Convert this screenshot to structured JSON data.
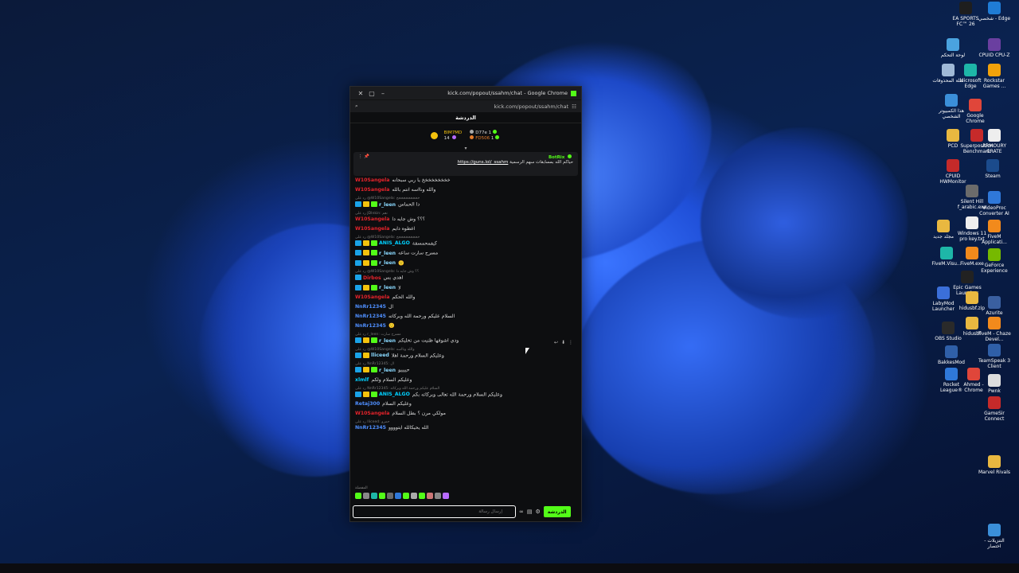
{
  "window": {
    "title": "kick.com/popout/ssahm/chat - Google Chrome",
    "url": "kick.com/popout/ssahm/chat"
  },
  "chat": {
    "header": "الدردشة",
    "leaderboard": [
      {
        "name": "BIM7MD",
        "count": "14"
      },
      {
        "name": "D77e",
        "count": "1"
      },
      {
        "name": "FD506",
        "count": "1"
      }
    ],
    "pinned": {
      "author": "BotRix",
      "text": "حياكم الله بمسابقات سهم الرسمية",
      "link": "https://guns.lol/_ssahm"
    },
    "messages": [
      {
        "reply": "",
        "user": "W10Sangela",
        "color": "#e5232b",
        "badges": 0,
        "text": "خخخخخخخخخ يا ربي سبحانه"
      },
      {
        "reply": "",
        "user": "W10Sangela",
        "color": "#e5232b",
        "badges": 0,
        "text": "والله ونااسه انتم بالله"
      },
      {
        "reply": "رد على @W10Sangela: خخخخخخخخخخ",
        "user": "r_leen",
        "color": "#8ad9ff",
        "badges": 3,
        "text": "دا الحماس"
      },
      {
        "reply": "رد على JDlnkin: نعم",
        "user": "W10Sangela",
        "color": "#e5232b",
        "badges": 0,
        "text": "؟؟؟ وش جايه دا"
      },
      {
        "reply": "",
        "user": "W10Sangela",
        "color": "#e5232b",
        "badges": 0,
        "text": "اعطوه دايم"
      },
      {
        "reply": "رد على @W10Sangela: خخخخخخخخخخ",
        "user": "ANIS_ALGO",
        "color": "#00d0ff",
        "badges": 3,
        "text": "كيفمحمسقة"
      },
      {
        "reply": "",
        "user": "r_leen",
        "color": "#8ad9ff",
        "badges": 3,
        "text": "مسرح سارت ساعه"
      },
      {
        "reply": "",
        "user": "r_leen",
        "color": "#8ad9ff",
        "badges": 3,
        "text": "🙂"
      },
      {
        "reply": "رد على @W10Sangela: ؟؟ وش جايه دا",
        "user": "Dirbos",
        "color": "#e5232b",
        "badges": 1,
        "text": "اهدي بس"
      },
      {
        "reply": "",
        "user": "r_leen",
        "color": "#8ad9ff",
        "badges": 3,
        "text": "لا"
      },
      {
        "reply": "",
        "user": "W10Sangela",
        "color": "#e5232b",
        "badges": 0,
        "text": "والله الحكم"
      },
      {
        "reply": "",
        "user": "NnRr12345",
        "color": "#4f8fff",
        "badges": 0,
        "text": "ال"
      },
      {
        "reply": "",
        "user": "NnRr12345",
        "color": "#4f8fff",
        "badges": 0,
        "text": "السلام عليكم ورحمة الله وبركاته"
      },
      {
        "reply": "",
        "user": "NnRr12345",
        "color": "#4f8fff",
        "badges": 0,
        "text": "🙂"
      },
      {
        "reply": "رد على r_leen: مسرح سارت",
        "user": "r_leen",
        "color": "#8ad9ff",
        "badges": 3,
        "text": "ودي اشوفها ظنيت من تخليكم"
      },
      {
        "reply": "رد على @W10Sangela: والله ونااسه",
        "user": "lliceed",
        "color": "#8ad9ff",
        "badges": 2,
        "text": "وعليكم السلام ورحمة اهلا"
      },
      {
        "reply": "رد على NnRr12345: ال",
        "user": "r_leen",
        "color": "#8ad9ff",
        "badges": 3,
        "text": "حييييو"
      },
      {
        "reply": "",
        "user": "xlmlf",
        "color": "#00d0ff",
        "badges": 0,
        "text": "وعليكم السلام ولكم"
      },
      {
        "reply": "رد على NnRr12345: السلام عليكم ورحمة الله وبركاته",
        "user": "ANIS_ALGO",
        "color": "#00d0ff",
        "badges": 3,
        "text": "وعليكم السلام ورحمة الله تعالى وبركاته بكم"
      },
      {
        "reply": "",
        "user": "Retaj300",
        "color": "#4f8fff",
        "badges": 0,
        "text": "وعليكم السلام"
      },
      {
        "reply": "",
        "user": "W10Sangela",
        "color": "#e5232b",
        "badges": 0,
        "text": "مولكي مرن ؟ بطل السلام"
      },
      {
        "reply": "رد على lliceed: حمرو",
        "user": "NnRr12345",
        "color": "#4f8fff",
        "badges": 0,
        "text": "الله يحيكالله ايتوووو"
      }
    ],
    "emote_label": "المفضلة",
    "input_placeholder": "إرسال رسالة",
    "send_label": "الدردشة"
  },
  "desktop_icons": [
    {
      "label": "EA SPORTS FC™ 26",
      "color": "#1e1e1e"
    },
    {
      "label": "شخصي - Edge",
      "color": "#1f7cd6"
    },
    {
      "label": "لوحة التحكم",
      "color": "#4aa3df"
    },
    {
      "label": "CPUID CPU-Z",
      "color": "#6a3fa0"
    },
    {
      "label": "سلة المحذوفات",
      "color": "#9fb9d6"
    },
    {
      "label": "Microsoft Edge",
      "color": "#1eb6a8"
    },
    {
      "label": "Rockstar Games ...",
      "color": "#f2a20b"
    },
    {
      "label": "هذا الكمبيوتر الشخصي",
      "color": "#3b8fd9"
    },
    {
      "label": "Google Chrome",
      "color": "#e0463a"
    },
    {
      "label": "PCD",
      "color": "#e9b840"
    },
    {
      "label": "Superposition Benchmark",
      "color": "#c62a2a"
    },
    {
      "label": "ARMOURY CRATE",
      "color": "#eeeeee"
    },
    {
      "label": "CPUID HWMonitor",
      "color": "#c52a2a"
    },
    {
      "label": "Steam",
      "color": "#1b4b8c"
    },
    {
      "label": "Silent Hill f_arabic.exe",
      "color": "#6b6b6b"
    },
    {
      "label": "VideoProc Converter AI",
      "color": "#2f78d9"
    },
    {
      "label": "مجلد جديد",
      "color": "#e9b840"
    },
    {
      "label": "Windows 11 pro key.txt",
      "color": "#eeeeee"
    },
    {
      "label": "FiveM Applicati...",
      "color": "#f28a1c"
    },
    {
      "label": "FiveM.Visu...",
      "color": "#1eb6a8"
    },
    {
      "label": "FiveM.exe",
      "color": "#f28a1c"
    },
    {
      "label": "GeForce Experience",
      "color": "#76b900"
    },
    {
      "label": "Epic Games Launcher",
      "color": "#222222"
    },
    {
      "label": "LabyMod Launcher",
      "color": "#3b6fd9"
    },
    {
      "label": "hidusbf.zip",
      "color": "#e9b840"
    },
    {
      "label": "Azurite",
      "color": "#3a5fa0"
    },
    {
      "label": "OBS Studio",
      "color": "#2a2a2a"
    },
    {
      "label": "hidusbf",
      "color": "#e9b840"
    },
    {
      "label": "FiveM - Chaze Devel...",
      "color": "#f28a1c"
    },
    {
      "label": "TeamSpeak 3 Client",
      "color": "#2f5fa8"
    },
    {
      "label": "BakkesMod",
      "color": "#2f5fa8"
    },
    {
      "label": "Rocket League®",
      "color": "#2f78d9"
    },
    {
      "label": "Ahmed - Chrome",
      "color": "#e0463a"
    },
    {
      "label": "Pwnk",
      "color": "#dddddd"
    },
    {
      "label": "GameSir Connect",
      "color": "#c62a2a"
    },
    {
      "label": "Marvel Rivals",
      "color": "#e9b840"
    },
    {
      "label": "التنزيلات - اختصار",
      "color": "#3b8fd9"
    }
  ]
}
